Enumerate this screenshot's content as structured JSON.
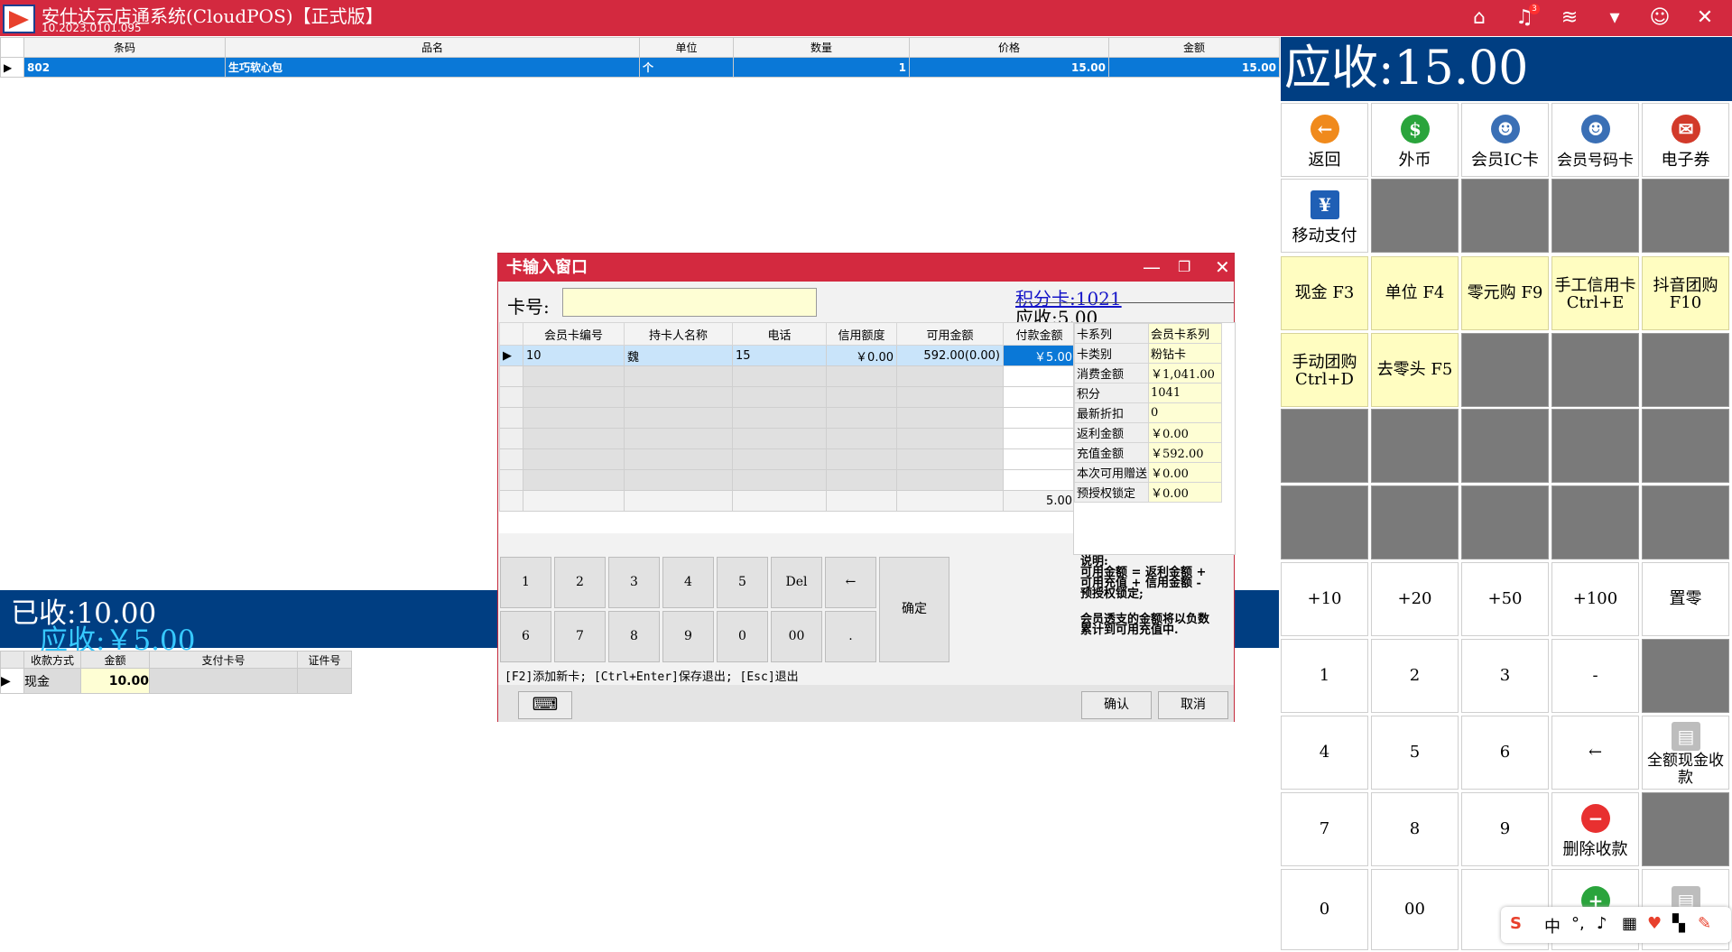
{
  "app": {
    "title": "安仕达云店通系统(CloudPOS)【正式版】",
    "version": "10.2023.0101.095",
    "notification_count": "3"
  },
  "item_grid": {
    "headers": [
      "条码",
      "品名",
      "单位",
      "数量",
      "价格",
      "金额"
    ],
    "rows": [
      {
        "barcode": "802",
        "name": "生巧软心包",
        "unit": "个",
        "qty": "1",
        "price": "15.00",
        "amount": "15.00"
      }
    ]
  },
  "received": {
    "label": "已收:10.00",
    "due": "应收:￥5.00"
  },
  "pay_grid": {
    "headers": [
      "收款方式",
      "金额",
      "支付卡号",
      "证件号"
    ],
    "rows": [
      {
        "method": "现金",
        "amount": "10.00",
        "card": "",
        "id": ""
      }
    ]
  },
  "right": {
    "due": "应收:15.00",
    "buttons": [
      {
        "label": "返回",
        "icon": "back-icon",
        "color": "#f08a1c",
        "glyph": "←"
      },
      {
        "label": "外币",
        "icon": "dollar-icon",
        "color": "#2aa43c",
        "glyph": "$"
      },
      {
        "label": "会员IC卡",
        "icon": "member-card-icon",
        "color": "#3a6fb5",
        "glyph": "☻"
      },
      {
        "label": "会员号码卡",
        "icon": "member-number-icon",
        "color": "#3a6fb5",
        "glyph": "☻"
      },
      {
        "label": "电子券",
        "icon": "gift-icon",
        "color": "#d23a2a",
        "glyph": "✉"
      },
      {
        "label": "移动支付",
        "icon": "yen-icon",
        "color": "#1f5fb5",
        "glyph": "¥"
      }
    ],
    "fkeys": [
      "现金 F3",
      "单位 F4",
      "零元购 F9",
      "手工信用卡\nCtrl+E",
      "抖音团购\nF10",
      "手动团购\nCtrl+D",
      "去零头 F5"
    ],
    "quick": [
      "+10",
      "+20",
      "+50",
      "+100",
      "置零"
    ],
    "digits": [
      "1",
      "2",
      "3",
      "-",
      "4",
      "5",
      "6",
      "←",
      "7",
      "8",
      "9",
      "0",
      "00"
    ],
    "full_cash": "全额现金收款",
    "delete_pay": "删除收款"
  },
  "dialog": {
    "title": "卡输入窗口",
    "card_label": "卡号:",
    "points": "积分卡:1021",
    "due": "应收:5.00",
    "grid_headers": [
      "会员卡编号",
      "持卡人名称",
      "电话",
      "信用额度",
      "可用金额",
      "付款金额"
    ],
    "row": {
      "card_no": "10",
      "holder": "魏",
      "phone": "15",
      "credit": "￥0.00",
      "available": "592.00(0.00)",
      "pay": "￥5.00"
    },
    "total": "5.00",
    "info": [
      [
        "卡系列",
        "会员卡系列"
      ],
      [
        "卡类别",
        "粉钻卡"
      ],
      [
        "消费金额",
        "￥1,041.00"
      ],
      [
        "积分",
        "1041"
      ],
      [
        "最新折扣",
        "0"
      ],
      [
        "返利金额",
        "￥0.00"
      ],
      [
        "充值金额",
        "￥592.00"
      ],
      [
        "本次可用赠送",
        "￥0.00"
      ],
      [
        "预授权锁定",
        "￥0.00"
      ]
    ],
    "keypad": [
      "1",
      "2",
      "3",
      "4",
      "5",
      "Del",
      "←",
      "6",
      "7",
      "8",
      "9",
      "0",
      "00",
      "."
    ],
    "enter": "确定",
    "notes": [
      "说明:",
      "可用金额 = 返利金额 +",
      "可用充值 + 信用金额 -",
      "预授权锁定;",
      "会员透支的金额将以负数",
      "累计到可用充值中."
    ],
    "hint": "[F2]添加新卡; [Ctrl+Enter]保存退出; [Esc]退出",
    "confirm": "确认",
    "cancel": "取消"
  },
  "ime": {
    "label": "中"
  }
}
